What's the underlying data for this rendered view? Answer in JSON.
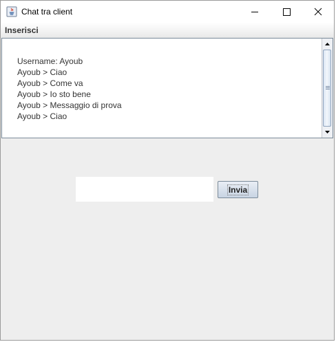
{
  "window": {
    "title": "Chat tra client",
    "controls": [
      "minimize-icon",
      "maximize-icon",
      "close-icon"
    ]
  },
  "menubar": {
    "items": [
      {
        "label": "Inserisci"
      }
    ]
  },
  "chat": {
    "lines": [
      "Username: Ayoub",
      "Ayoub > Ciao",
      "Ayoub > Come va",
      "Ayoub > Io sto bene",
      "Ayoub > Messaggio di prova",
      "Ayoub > Ciao"
    ]
  },
  "composer": {
    "input_value": "",
    "send_label": "Invia"
  },
  "colors": {
    "window_bg": "#eeeeee",
    "scroll_thumb": "#dbe6f3",
    "button_bg": "#c8d4e3"
  }
}
